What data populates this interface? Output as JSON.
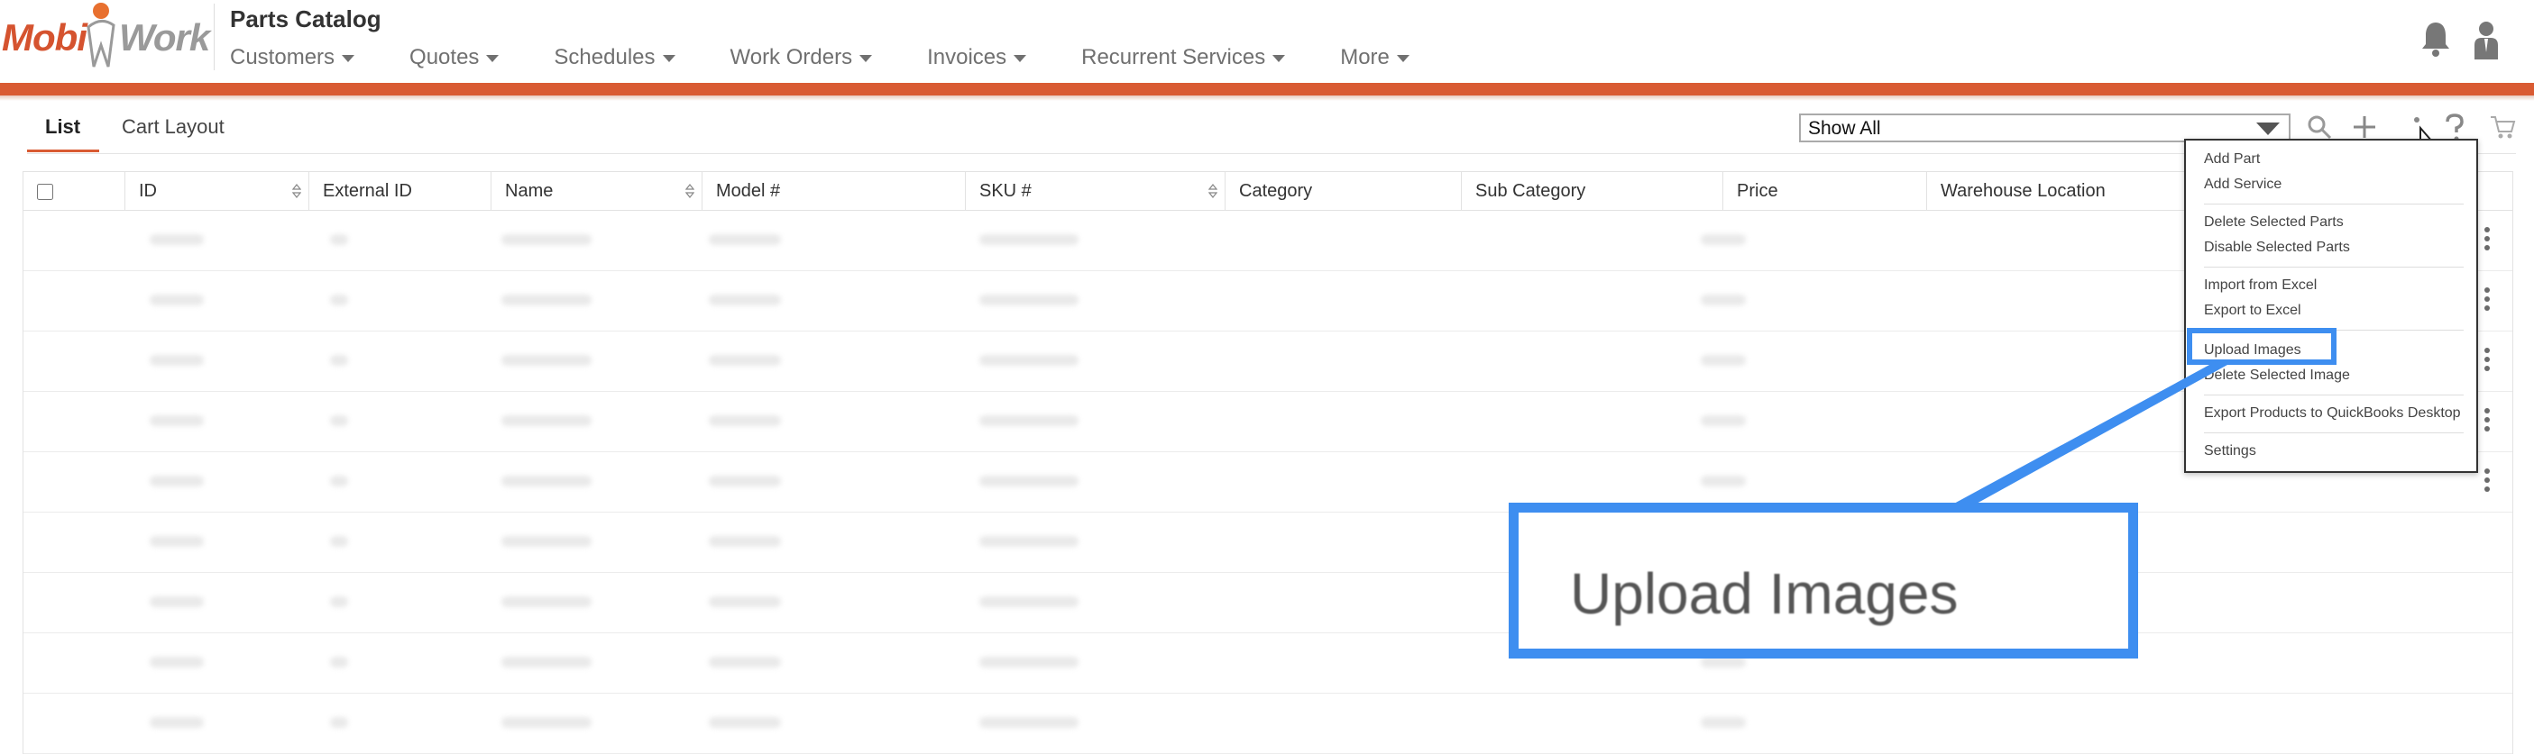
{
  "brand": {
    "logo_left": "Mobi",
    "logo_right": "Work",
    "orange": "#d95b33",
    "gray": "#9a9a9a"
  },
  "header": {
    "title": "Parts Catalog",
    "nav": [
      "Customers",
      "Quotes",
      "Schedules",
      "Work Orders",
      "Invoices",
      "Recurrent Services",
      "More"
    ],
    "icons": [
      "bell-icon",
      "user-icon"
    ]
  },
  "tabs": [
    "List",
    "Cart Layout"
  ],
  "filter": {
    "selected": "Show All"
  },
  "toolbar_icons": [
    "search-icon",
    "plus-icon",
    "more-icon",
    "help-icon",
    "cart-icon"
  ],
  "table": {
    "columns": [
      "ID",
      "External ID",
      "Name",
      "Model #",
      "SKU #",
      "Category",
      "Sub Category",
      "Price",
      "Warehouse Location"
    ]
  },
  "menu": {
    "items": [
      "Add Part",
      "Add Service",
      "Delete Selected Parts",
      "Disable Selected Parts",
      "Import from Excel",
      "Export to Excel",
      "Upload Images",
      "Delete Selected Image",
      "Export Products to QuickBooks Desktop",
      "Settings"
    ]
  },
  "callout": {
    "label": "Upload Images",
    "color": "#3e8ef0"
  }
}
